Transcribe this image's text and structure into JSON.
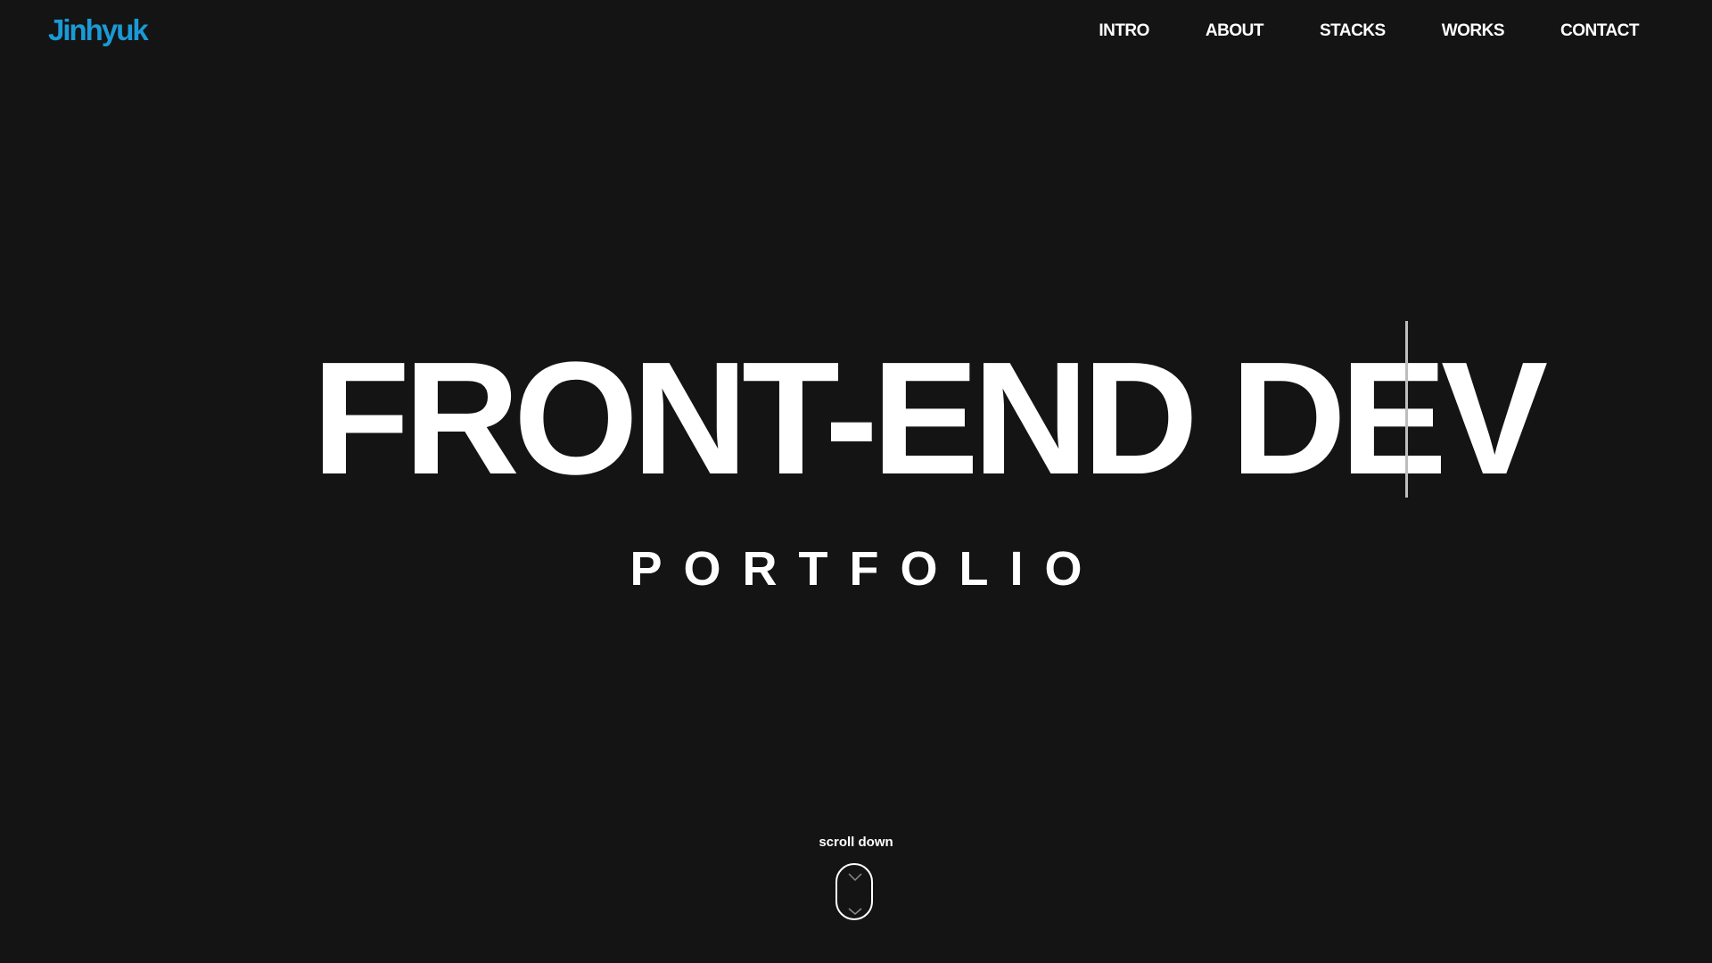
{
  "header": {
    "logo": "Jinhyuk",
    "nav": [
      "INTRO",
      "ABOUT",
      "STACKS",
      "WORKS",
      "CONTACT"
    ]
  },
  "hero": {
    "title": "FRONT-END DEV",
    "subtitle": "PORTFOLIO"
  },
  "scroll": {
    "label": "scroll down",
    "icon": "mouse-scroll-icon"
  },
  "colors": {
    "background": "#141414",
    "accent": "#1a9ad6",
    "text": "#ffffff"
  }
}
